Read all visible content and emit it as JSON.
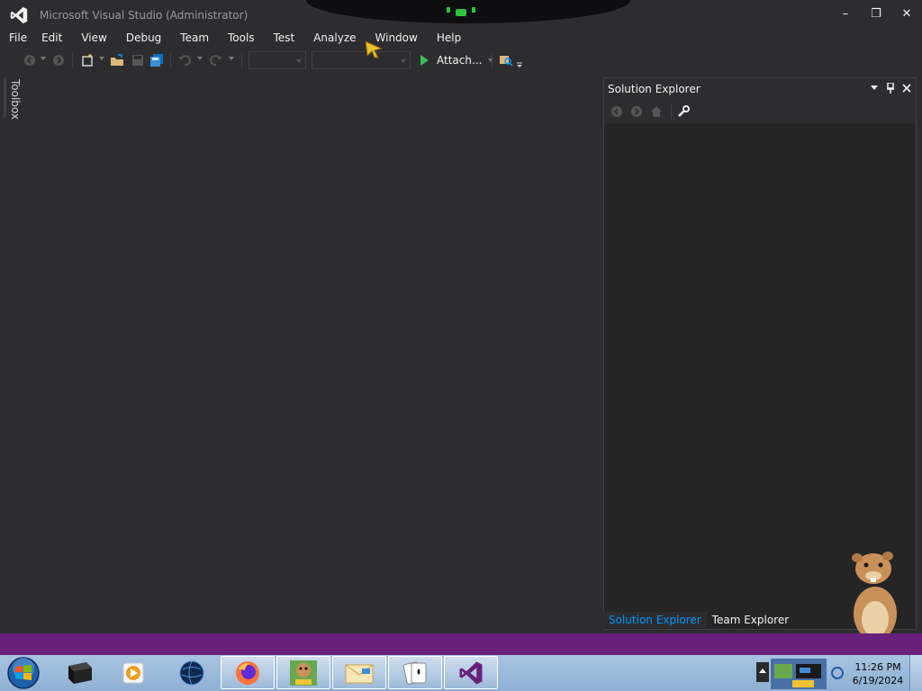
{
  "window": {
    "title": "Microsoft Visual Studio (Administrator)",
    "minimize_glyph": "–",
    "restore_glyph": "❒",
    "close_glyph": "✕"
  },
  "menu": {
    "items": [
      "File",
      "Edit",
      "View",
      "Debug",
      "Team",
      "Tools",
      "Test",
      "Analyze",
      "Window",
      "Help"
    ]
  },
  "toolbar": {
    "attach_label": "Attach...",
    "icons": [
      "back-icon",
      "forward-icon",
      "new-project-icon",
      "open-file-icon",
      "save-icon",
      "save-all-icon",
      "undo-icon",
      "redo-icon",
      "start-icon",
      "find-in-files-icon"
    ]
  },
  "toolbox": {
    "label": "Toolbox"
  },
  "solution_explorer": {
    "title": "Solution Explorer",
    "tabs": [
      {
        "label": "Solution Explorer",
        "active": true
      },
      {
        "label": "Team Explorer",
        "active": false
      }
    ]
  },
  "status_bar": {
    "color": "#68217a"
  },
  "taskbar": {
    "clock_time": "11:26 PM",
    "clock_date": "6/19/2024",
    "items": [
      "terminal-icon",
      "media-player-icon",
      "globe-icon",
      "firefox-icon",
      "game-box-icon",
      "mail-icon",
      "solitaire-icon",
      "visual-studio-icon"
    ]
  },
  "colors": {
    "accent": "#0097fb",
    "vs_purple": "#68217a",
    "play_green": "#3dbd58",
    "background": "#2d2d30"
  }
}
